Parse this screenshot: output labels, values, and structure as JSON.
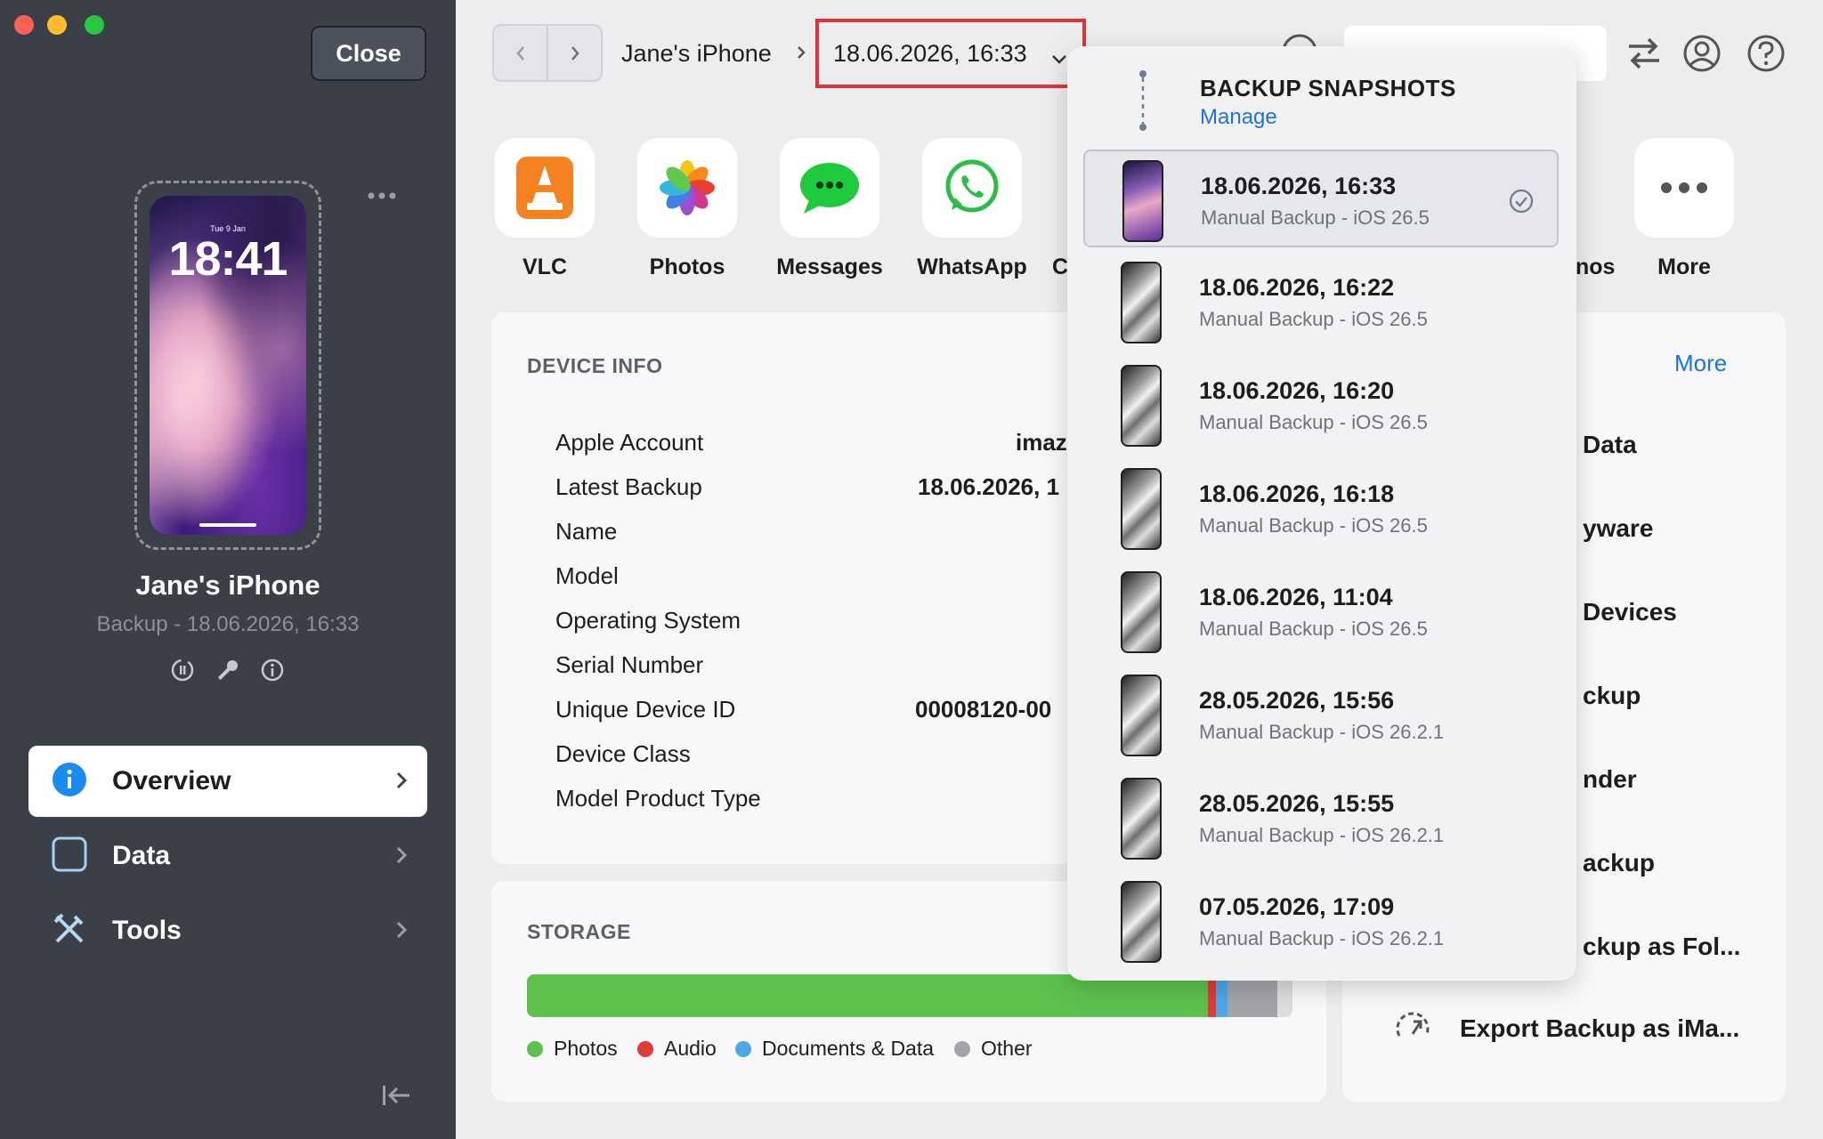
{
  "window": {
    "close_label": "Close"
  },
  "device": {
    "name": "Jane's iPhone",
    "subtitle": "Backup - 18.06.2026, 16:33",
    "lock_time": "18:41",
    "lock_date": "Tue 9 Jan"
  },
  "sidebar": {
    "items": [
      {
        "label": "Overview",
        "icon": "info-icon",
        "selected": true
      },
      {
        "label": "Data",
        "icon": "square-icon"
      },
      {
        "label": "Tools",
        "icon": "tools-icon"
      }
    ]
  },
  "breadcrumb": {
    "device": "Jane's iPhone",
    "snapshot": "18.06.2026, 16:33"
  },
  "apps": [
    {
      "label": "VLC",
      "icon": "vlc-icon"
    },
    {
      "label": "Photos",
      "icon": "photos-icon"
    },
    {
      "label": "Messages",
      "icon": "messages-icon"
    },
    {
      "label": "WhatsApp",
      "icon": "whatsapp-icon"
    },
    {
      "label": "C",
      "icon": "partial-app-label"
    },
    {
      "label": "nos",
      "icon": "partial-app-label"
    },
    {
      "label": "More",
      "icon": "more-icon"
    }
  ],
  "device_info": {
    "title": "DEVICE INFO",
    "rows": [
      {
        "label": "Apple Account",
        "value": "imaz"
      },
      {
        "label": "Latest Backup",
        "value": "18.06.2026, 1"
      },
      {
        "label": "Name",
        "value": ""
      },
      {
        "label": "Model",
        "value": ""
      },
      {
        "label": "Operating System",
        "value": ""
      },
      {
        "label": "Serial Number",
        "value": ""
      },
      {
        "label": "Unique Device ID",
        "value": "00008120-00"
      },
      {
        "label": "Device Class",
        "value": ""
      },
      {
        "label": "Model Product Type",
        "value": ""
      }
    ]
  },
  "storage": {
    "title": "STORAGE",
    "segments": [
      {
        "name": "Photos",
        "fraction": 0.89,
        "color": "#5cc24c"
      },
      {
        "name": "Audio",
        "fraction": 0.01,
        "color": "#e23a3a"
      },
      {
        "name": "Documents & Data",
        "fraction": 0.015,
        "color": "#4da8e8"
      },
      {
        "name": "Other",
        "fraction": 0.065,
        "color": "#a2a4a8"
      }
    ],
    "legend": [
      "Photos",
      "Audio",
      "Documents & Data",
      "Other"
    ]
  },
  "right_panel": {
    "more_label": "More",
    "items": [
      "Data",
      "yware",
      "Devices",
      "ckup",
      "nder",
      "ackup",
      "ckup as Fol..."
    ],
    "export_label": "Export Backup as iMa..."
  },
  "snapshots": {
    "title": "BACKUP SNAPSHOTS",
    "manage_label": "Manage",
    "items": [
      {
        "date": "18.06.2026, 16:33",
        "desc": "Manual Backup - iOS 26.5",
        "selected": true
      },
      {
        "date": "18.06.2026, 16:22",
        "desc": "Manual Backup - iOS 26.5"
      },
      {
        "date": "18.06.2026, 16:20",
        "desc": "Manual Backup - iOS 26.5"
      },
      {
        "date": "18.06.2026, 16:18",
        "desc": "Manual Backup - iOS 26.5"
      },
      {
        "date": "18.06.2026, 11:04",
        "desc": "Manual Backup - iOS 26.5"
      },
      {
        "date": "28.05.2026, 15:56",
        "desc": "Manual Backup - iOS 26.2.1"
      },
      {
        "date": "28.05.2026, 15:55",
        "desc": "Manual Backup - iOS 26.2.1"
      },
      {
        "date": "07.05.2026, 17:09",
        "desc": "Manual Backup - iOS 26.2.1"
      }
    ]
  },
  "colors": {
    "accent": "#1a73e8",
    "sidebar": "#3a3f48",
    "highlight_border": "#e23237"
  }
}
